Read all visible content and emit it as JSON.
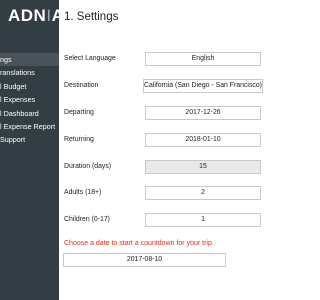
{
  "app": {
    "logo_main": "ADN",
    "logo_sep": "I",
    "logo_tail": "A"
  },
  "sidebar": {
    "items": [
      {
        "label": "ngs",
        "active": true
      },
      {
        "label": "ranslations",
        "active": false
      },
      {
        "label": "l Budget",
        "active": false
      },
      {
        "label": "l Expenses",
        "active": false
      },
      {
        "label": "l Dashboard",
        "active": false
      },
      {
        "label": "l Expense Report",
        "active": false
      },
      {
        "label": "Support",
        "active": false
      }
    ]
  },
  "page": {
    "title": "1. Settings"
  },
  "settings": {
    "language": {
      "label": "Select Language",
      "value": "English"
    },
    "destination": {
      "label": "Destination",
      "value": "California (San Diego - San Francisco)"
    },
    "departing": {
      "label": "Departing",
      "value": "2017-12-26"
    },
    "returning": {
      "label": "Returning",
      "value": "2018-01-10"
    },
    "duration": {
      "label": "Duration (days)",
      "value": "15"
    },
    "adults": {
      "label": "Adults (18+)",
      "value": "2"
    },
    "children": {
      "label": "Children (0-17)",
      "value": "1"
    }
  },
  "countdown": {
    "hint": "Choose a date to start a countdown for your trip.",
    "value": "2017-08-10"
  },
  "colors": {
    "sidebar_bg": "#333d44",
    "active_item_bg": "#4a5359",
    "hint_text": "#e0301e",
    "readonly_bg": "#e9e9e9"
  }
}
